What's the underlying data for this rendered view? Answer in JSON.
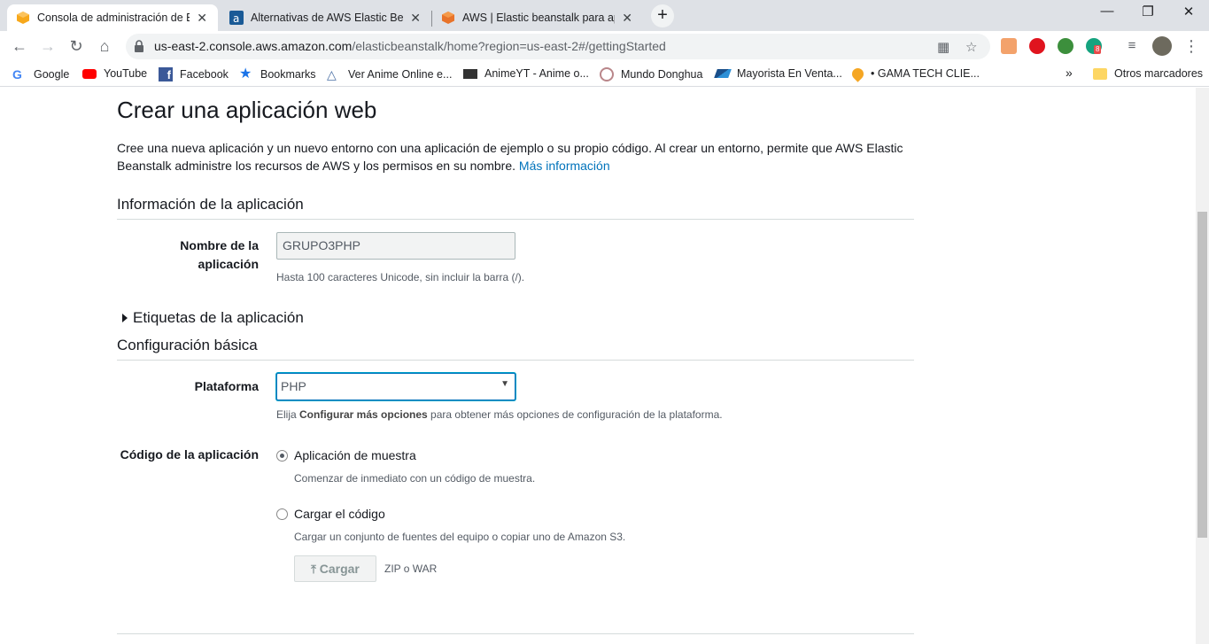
{
  "browser": {
    "tabs": [
      {
        "title": "Consola de administración de Ela",
        "close": "✕",
        "active": true
      },
      {
        "title": "Alternativas de AWS Elastic Beans",
        "close": "✕",
        "active": false
      },
      {
        "title": "AWS | Elastic beanstalk para aplic",
        "close": "✕",
        "active": false
      }
    ],
    "new_tab": "+",
    "window_controls": {
      "minimize": "—",
      "restore": "❐",
      "close": "✕"
    },
    "url_host": "us-east-2.console.aws.amazon.com",
    "url_path": "/elasticbeanstalk/home?region=us-east-2#/gettingStarted",
    "extension_badge": "8",
    "bookmarks": [
      {
        "label": "Google",
        "icon": "google-icon"
      },
      {
        "label": "YouTube",
        "icon": "youtube-icon"
      },
      {
        "label": "Facebook",
        "icon": "facebook-icon"
      },
      {
        "label": "Bookmarks",
        "icon": "star-icon"
      },
      {
        "label": "Ver Anime Online e...",
        "icon": "anime-icon"
      },
      {
        "label": "AnimeYT - Anime o...",
        "icon": "video-icon"
      },
      {
        "label": "Mundo Donghua",
        "icon": "donghua-icon"
      },
      {
        "label": "Mayorista En Venta...",
        "icon": "mayorista-icon"
      },
      {
        "label": "• GAMA TECH CLIE...",
        "icon": "gama-icon"
      }
    ],
    "bookmarks_overflow": "»",
    "other_bookmarks": "Otros marcadores"
  },
  "page": {
    "title": "Crear una aplicación web",
    "intro_text": "Cree una nueva aplicación y un nuevo entorno con una aplicación de ejemplo o su propio código. Al crear un entorno, permite que AWS Elastic Beanstalk administre los recursos de AWS y los permisos en su nombre.",
    "more_info_link": "Más información",
    "app_info": {
      "section_title": "Información de la aplicación",
      "name_label_line1": "Nombre de la",
      "name_label_line2": "aplicación",
      "name_value": "GRUPO3PHP",
      "name_help": "Hasta 100 caracteres Unicode, sin incluir la barra (/)."
    },
    "tags_toggle": "Etiquetas de la aplicación",
    "basic_config": {
      "section_title": "Configuración básica",
      "platform_label": "Plataforma",
      "platform_value": "PHP",
      "platform_help_prefix": "Elija ",
      "platform_help_bold": "Configurar más opciones",
      "platform_help_suffix": " para obtener más opciones de configuración de la plataforma."
    },
    "app_code": {
      "label": "Código de la aplicación",
      "options": [
        {
          "label": "Aplicación de muestra",
          "help": "Comenzar de inmediato con un código de muestra.",
          "selected": true
        },
        {
          "label": "Cargar el código",
          "help": "Cargar un conjunto de fuentes del equipo o copiar uno de Amazon S3.",
          "selected": false
        }
      ],
      "upload_button": "Cargar",
      "upload_hint": "ZIP o WAR"
    }
  },
  "colors": {
    "link": "#0073bb",
    "focus": "#00a1c9",
    "aws_orange": "#ff9900"
  }
}
